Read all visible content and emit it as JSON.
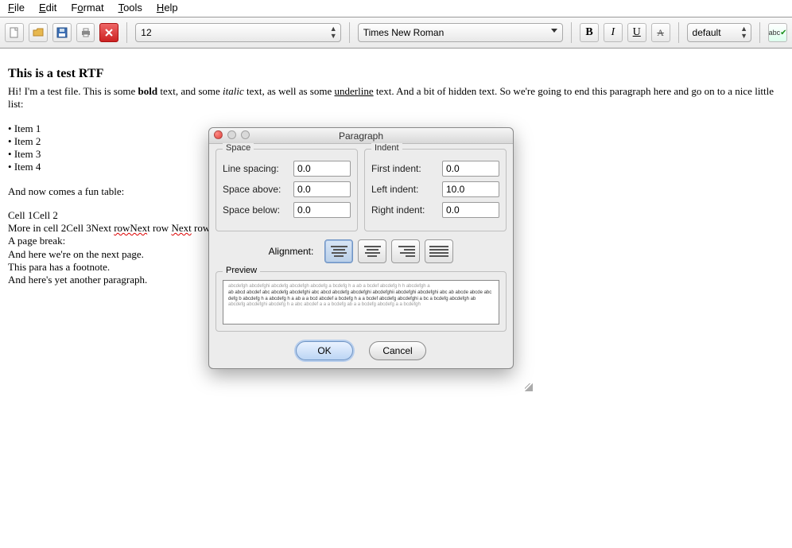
{
  "menu": {
    "file": "File",
    "edit": "Edit",
    "format": "Format",
    "tools": "Tools",
    "help": "Help",
    "file_u": "F",
    "edit_u": "E",
    "format_u": "o",
    "tools_u": "T",
    "help_u": "H"
  },
  "toolbar": {
    "font_size": "12",
    "font_name": "Times New Roman",
    "style_name": "default",
    "bold": "B",
    "italic": "I",
    "underline": "U",
    "strike": "A"
  },
  "doc": {
    "title": "This is a test RTF",
    "p1a": "Hi! I'm a test file. This is some ",
    "p1b": "bold",
    "p1c": " text, and some ",
    "p1d": "italic",
    "p1e": " text, as well as some ",
    "p1f": "underline",
    "p1g": " text. And a bit of hidden text. So we're going to end this paragraph here and go on to a nice little list:",
    "items": [
      "Item 1",
      "Item 2",
      "Item 3",
      "Item 4"
    ],
    "p2": "And now comes a fun table:",
    "p3": "Cell 1Cell 2",
    "p4a": "More in cell 2Cell 3Next ",
    "p4b": "rowNex",
    "p4c": "t row ",
    "p4d": "Next",
    "p4e": " row",
    "p5": "A page break:",
    "p6": "And here we're on the next page.",
    "p7": "This para has a footnote.",
    "p8": "And here's yet another paragraph."
  },
  "dialog": {
    "title": "Paragraph",
    "space_legend": "Space",
    "indent_legend": "Indent",
    "line_spacing_lbl": "Line spacing:",
    "line_spacing": "0.0",
    "space_above_lbl": "Space above:",
    "space_above": "0.0",
    "space_below_lbl": "Space below:",
    "space_below": "0.0",
    "first_indent_lbl": "First indent:",
    "first_indent": "0.0",
    "left_indent_lbl": "Left indent:",
    "left_indent": "10.0",
    "right_indent_lbl": "Right indent:",
    "right_indent": "0.0",
    "alignment_lbl": "Alignment:",
    "preview_legend": "Preview",
    "preview_grey": "abcdefgh abcdefghi abcdefg abcdefgh abcdefg a bcdefg h a ab a bcdef abcdefg h h abcdefgh a",
    "preview_dark": "ab abcd abcdef abc abcdefg abcdefghi abc abcd abcdefg abcdefghi abcdefghii abcdefghi abcdefghi abc ab abcde abcde abcdefg b abcdefg h a abcdefg h a ab a a bcd abcdef a bcdefg h a a bcdef abcdefg abcdefghi a bc a bcdefg abcdefgh ab",
    "preview_grey2": "abcdefg abcdefghi abcdefg h a abc abcdef a a a bcdefg ab a a bcdefg abcdefg a a bcdefgh",
    "ok": "OK",
    "cancel": "Cancel"
  }
}
